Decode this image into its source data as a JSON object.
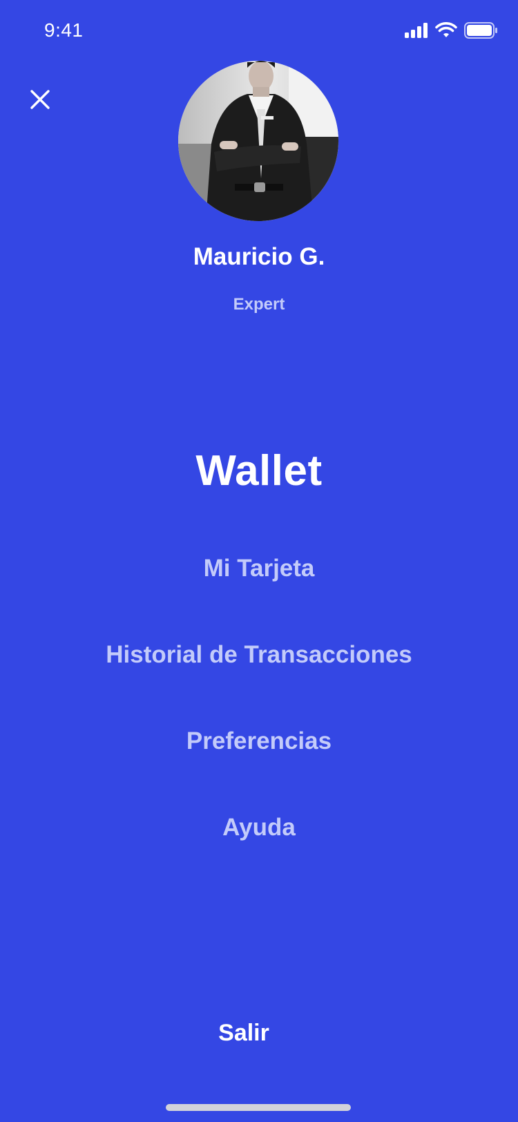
{
  "status_bar": {
    "time": "9:41",
    "icons": [
      "signal-icon",
      "wifi-icon",
      "battery-icon"
    ]
  },
  "header": {
    "close_icon": "close-icon"
  },
  "profile": {
    "name": "Mauricio G.",
    "level": "Expert"
  },
  "menu": {
    "title": "Wallet",
    "items": [
      {
        "label": "Mi Tarjeta"
      },
      {
        "label": "Historial de Transacciones"
      },
      {
        "label": "Preferencias"
      },
      {
        "label": "Ayuda"
      }
    ]
  },
  "footer": {
    "logout_label": "Salir"
  },
  "colors": {
    "background": "#3447E4",
    "text_primary": "#FFFFFF",
    "text_muted": "#C3CBFA",
    "home_indicator": "#D2D2DA"
  }
}
